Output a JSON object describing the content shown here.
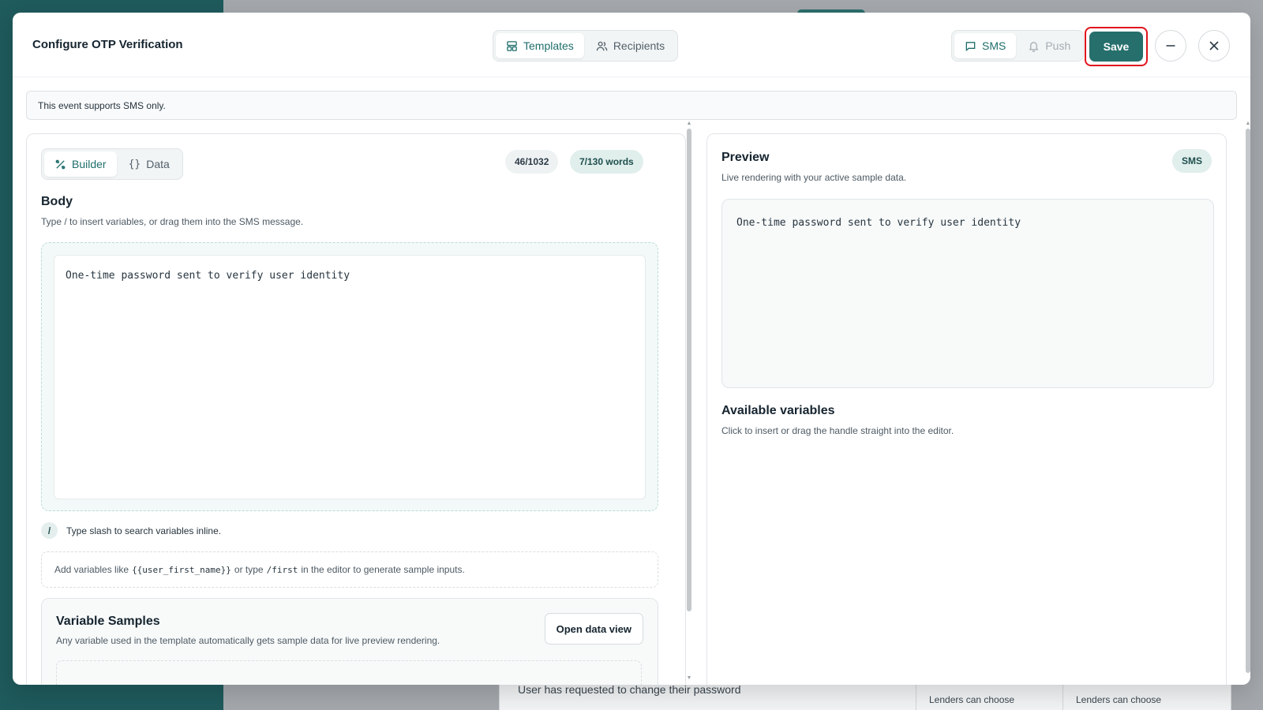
{
  "background": {
    "row_text": "User has requested to change their password",
    "cells": [
      "Lenders can choose",
      "Lenders can choose"
    ]
  },
  "modal": {
    "title": "Configure OTP Verification",
    "tabs": [
      {
        "label": "Templates",
        "icon": "layout-template-icon",
        "active": true
      },
      {
        "label": "Recipients",
        "icon": "users-icon",
        "active": false
      }
    ],
    "channels": [
      {
        "label": "SMS",
        "icon": "message-square-icon",
        "active": true
      },
      {
        "label": "Push",
        "icon": "bell-icon",
        "active": false
      }
    ],
    "save_label": "Save",
    "notice": "This event supports SMS only."
  },
  "left": {
    "modes": [
      {
        "label": "Builder",
        "icon": "builder-icon",
        "active": true
      },
      {
        "label": "Data",
        "icon": "braces-icon",
        "active": false
      }
    ],
    "char_count": "46/1032",
    "word_count": "7/130 words",
    "body_title": "Body",
    "body_sub": "Type / to insert variables, or drag them into the SMS message.",
    "editor_text": "One-time password sent to verify user identity",
    "slash_badge": "/",
    "slash_hint": "Type slash to search variables inline.",
    "vars_hint_pre": "Add variables like",
    "vars_hint_code1": "{{user_first_name}}",
    "vars_hint_mid": "or type",
    "vars_hint_code2": "/first",
    "vars_hint_post": "in the editor to generate sample inputs.",
    "samples_title": "Variable Samples",
    "samples_sub": "Any variable used in the template automatically gets sample data for live preview rendering.",
    "open_data_label": "Open data view"
  },
  "right": {
    "preview_title": "Preview",
    "preview_sub": "Live rendering with your active sample data.",
    "channel_badge": "SMS",
    "preview_text": "One-time password sent to verify user identity",
    "vars_title": "Available variables",
    "vars_sub": "Click to insert or drag the handle straight into the editor."
  },
  "colors": {
    "accent": "#266f6c",
    "highlight": "#e0141c"
  }
}
